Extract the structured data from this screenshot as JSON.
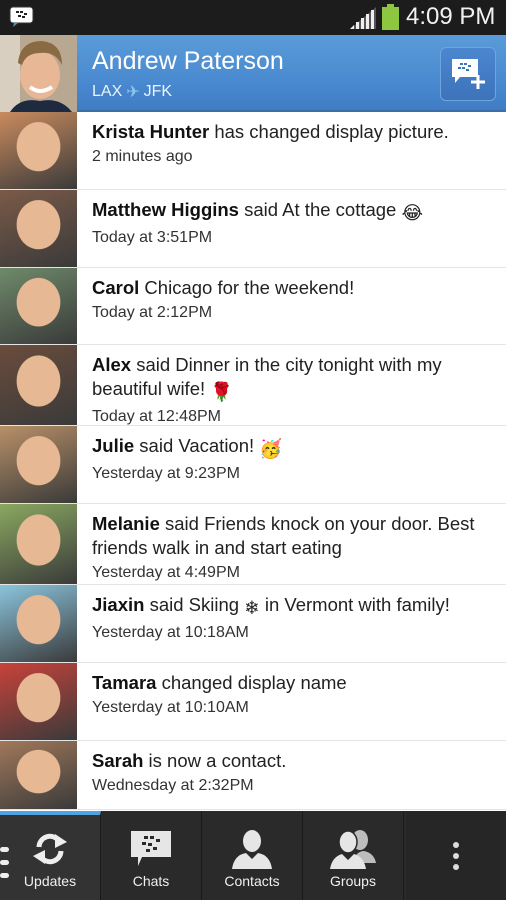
{
  "status_bar": {
    "time": "4:09 PM",
    "battery_color": "#8dc63f"
  },
  "header": {
    "name": "Andrew Paterson",
    "route_from": "LAX",
    "route_to": "JFK",
    "plane_icon": "airplane-icon",
    "compose_icon": "new-chat-icon",
    "accent": "#4a8ad0"
  },
  "updates": [
    {
      "name": "Krista Hunter",
      "text": " has changed display picture.",
      "time": "2 minutes ago",
      "emoji": "",
      "avatar_color": "#c98b5e"
    },
    {
      "name": "Matthew Higgins",
      "text": " said At the cottage ",
      "time": "Today at 3:51PM",
      "emoji": "😂",
      "avatar_color": "#7a5a48"
    },
    {
      "name": "Carol",
      "text": " Chicago for the weekend!",
      "time": "Today at 2:12PM",
      "emoji": "",
      "avatar_color": "#6e8a6a"
    },
    {
      "name": "Alex",
      "text": " said Dinner in the city tonight with my beautiful wife! ",
      "time": "Today at 12:48PM",
      "emoji": "🌹",
      "avatar_color": "#6a4c3c"
    },
    {
      "name": "Julie",
      "text": " said Vacation! ",
      "time": "Yesterday at 9:23PM",
      "emoji": "🥳",
      "avatar_color": "#b89068"
    },
    {
      "name": "Melanie",
      "text": " said Friends knock on your door. Best friends walk in and start eating",
      "time": "Yesterday at 4:49PM",
      "emoji": "",
      "avatar_color": "#8aa860"
    },
    {
      "name": "Jiaxin",
      "text": " said Skiing ",
      "text2": " in Vermont with family!",
      "time": "Yesterday at 10:18AM",
      "emoji": "❄",
      "avatar_color": "#8bc4dc"
    },
    {
      "name": "Tamara",
      "text": " changed display name",
      "time": "Yesterday at 10:10AM",
      "emoji": "",
      "avatar_color": "#c8423a"
    },
    {
      "name": "Sarah",
      "text": " is now a contact.",
      "time": "Wednesday at 2:32PM",
      "emoji": "",
      "avatar_color": "#a0785a"
    }
  ],
  "nav": {
    "tabs": [
      {
        "label": "Updates",
        "icon": "refresh-icon",
        "active": true
      },
      {
        "label": "Chats",
        "icon": "chat-bubble-icon",
        "active": false
      },
      {
        "label": "Contacts",
        "icon": "person-icon",
        "active": false
      },
      {
        "label": "Groups",
        "icon": "people-icon",
        "active": false
      }
    ],
    "overflow_icon": "more-vertical-icon"
  }
}
